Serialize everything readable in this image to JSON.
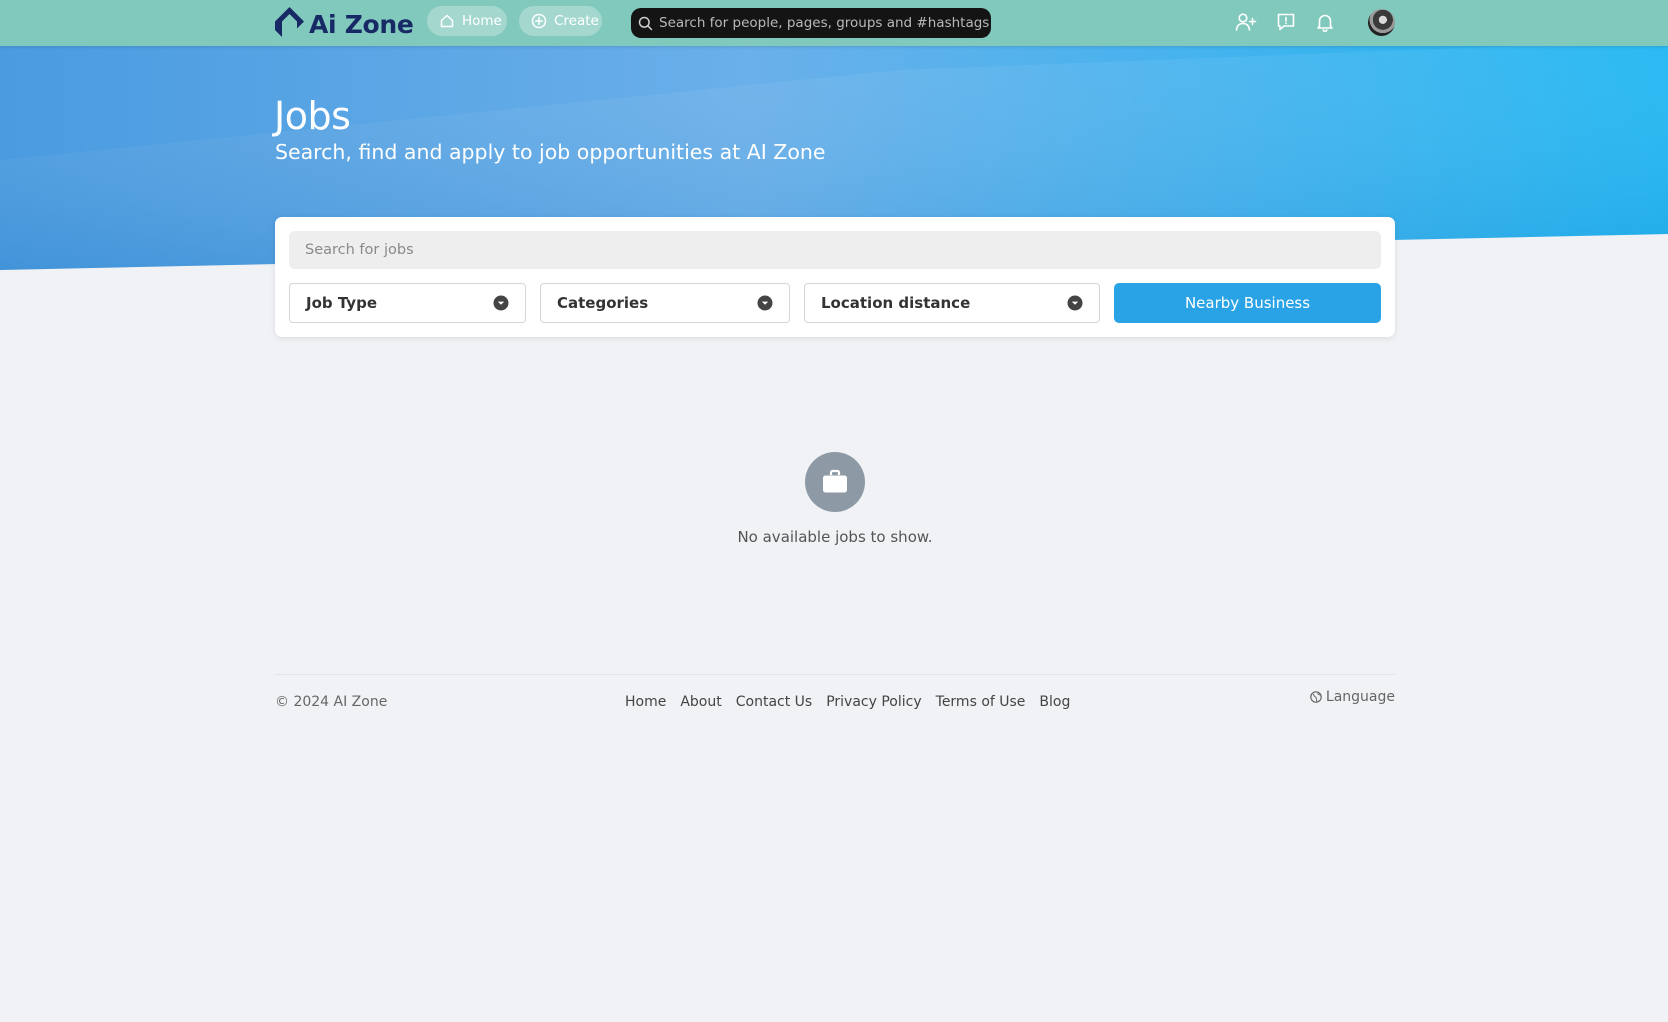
{
  "topbar": {
    "brand": "Ai Zone",
    "home_label": "Home",
    "create_label": "Create",
    "search_placeholder": "Search for people, pages, groups and #hashtags",
    "icons": [
      "add-friend-icon",
      "messages-icon",
      "bell-icon"
    ]
  },
  "hero": {
    "title": "Jobs",
    "subtitle": "Search, find and apply to job opportunities at AI Zone"
  },
  "filters": {
    "search_placeholder": "Search for jobs",
    "job_type": "Job Type",
    "categories": "Categories",
    "location": "Location distance",
    "nearby_button": "Nearby Business"
  },
  "empty_state": {
    "icon": "briefcase-icon",
    "message": "No available jobs to show."
  },
  "footer": {
    "copyright": "© 2024 AI Zone",
    "links": [
      "Home",
      "About",
      "Contact Us",
      "Privacy Policy",
      "Terms of Use",
      "Blog"
    ],
    "language": "Language"
  },
  "colors": {
    "topbar": "#82c9bd",
    "accent": "#2aa3e6",
    "brand_text": "#172a66",
    "page_bg": "#f0f2f5"
  }
}
